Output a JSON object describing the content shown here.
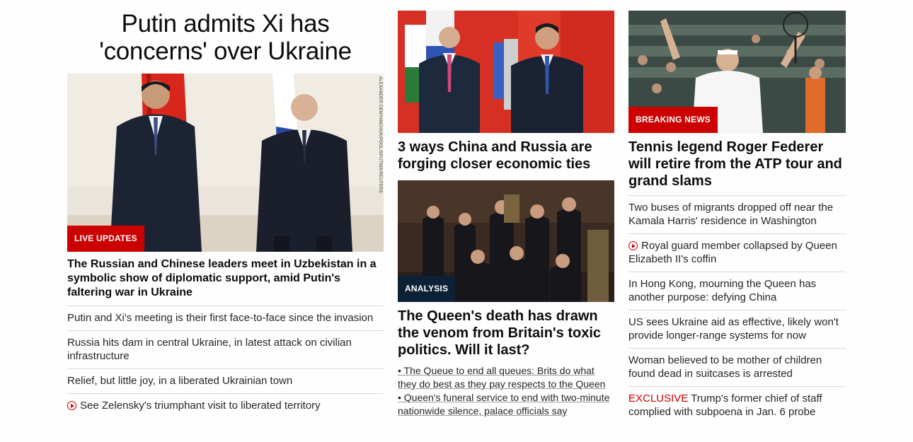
{
  "col1": {
    "headline": "Putin admits Xi has 'concerns' over Ukraine",
    "photo_credit": "ALEXANDER DEMYANCHUK/POOL/SPUTNIK/REUTERS",
    "badge": "LIVE UPDATES",
    "lead": "The Russian and Chinese leaders meet in Uzbekistan in a symbolic show of diplomatic support, amid Putin's faltering war in Ukraine",
    "links": [
      {
        "text": "Putin and Xi's meeting is their first face-to-face since the invasion"
      },
      {
        "text": "Russia hits dam in central Ukraine, in latest attack on civilian infrastructure"
      },
      {
        "text": "Relief, but little joy, in a liberated Ukrainian town"
      },
      {
        "text": "See Zelensky's triumphant visit to liberated territory",
        "icon": "play-video-icon"
      }
    ]
  },
  "col2": {
    "story1": {
      "headline": "3 ways China and Russia are forging closer economic ties"
    },
    "story2": {
      "badge": "ANALYSIS",
      "headline": "The Queen's death has drawn the venom from Britain's toxic politics. Will it last?",
      "bullets": [
        "• The Queue to end all queues: Brits do what they do best as they pay respects to the Queen",
        "• Queen's funeral service to end with two-minute nationwide silence, palace officials say"
      ]
    }
  },
  "col3": {
    "badge": "BREAKING NEWS",
    "lead": "Tennis legend Roger Federer will retire from the ATP tour and grand slams",
    "links": [
      {
        "text": "Two buses of migrants dropped off near the Kamala Harris' residence in Washington"
      },
      {
        "text": "Royal guard member collapsed by Queen Elizabeth II's coffin",
        "icon": "play-video-icon"
      },
      {
        "text": "In Hong Kong, mourning the Queen has another purpose: defying China"
      },
      {
        "text": "US sees Ukraine aid as effective, likely won't provide longer-range systems for now"
      },
      {
        "text": "Woman believed to be mother of children found dead in suitcases is arrested"
      },
      {
        "prefix": "EXCLUSIVE",
        "text": " Trump's former chief of staff complied with subpoena in Jan. 6 probe"
      }
    ]
  },
  "colors": {
    "accent_red": "#cc0000",
    "analysis_navy": "#0d2136"
  }
}
